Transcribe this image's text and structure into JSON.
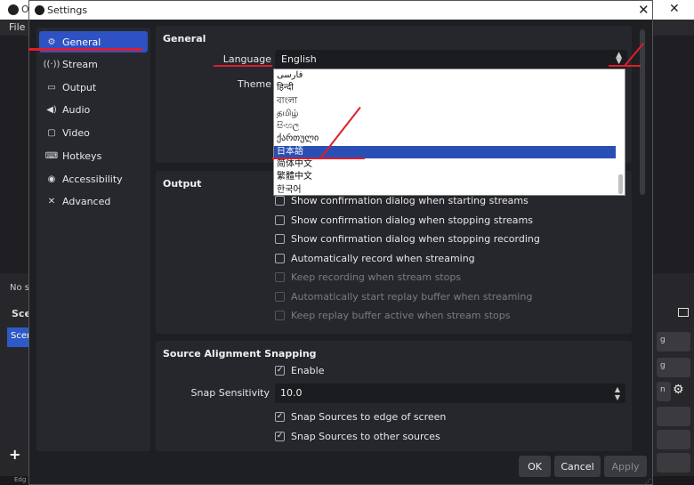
{
  "background_window": {
    "title": "Ol",
    "menu_file": "File",
    "no_source": "No so",
    "scenes_header": "Scen",
    "scene_item": "Scer",
    "plus": "+",
    "right_btn_labels": [
      "g",
      "g",
      "n"
    ],
    "bottom_text": "Edg"
  },
  "dialog": {
    "title": "Settings",
    "close": "✕"
  },
  "sidebar": {
    "items": [
      {
        "label": "General",
        "icon": "gear-icon"
      },
      {
        "label": "Stream",
        "icon": "antenna-icon"
      },
      {
        "label": "Output",
        "icon": "monitor-icon"
      },
      {
        "label": "Audio",
        "icon": "speaker-icon"
      },
      {
        "label": "Video",
        "icon": "display-icon"
      },
      {
        "label": "Hotkeys",
        "icon": "keyboard-icon"
      },
      {
        "label": "Accessibility",
        "icon": "accessibility-icon"
      },
      {
        "label": "Advanced",
        "icon": "wrench-icon"
      }
    ]
  },
  "general": {
    "title": "General",
    "language_label": "Language",
    "language_value": "English",
    "theme_label": "Theme"
  },
  "language_dropdown": {
    "options": [
      "فارسی",
      "हिन्दी",
      "বাংলা",
      "தமிழ்",
      "සිංහල",
      "ქართული",
      "日本語",
      "简体中文",
      "繁體中文",
      "한국어"
    ],
    "selected_index": 6
  },
  "output": {
    "title": "Output",
    "checks": [
      {
        "label": "Show confirmation dialog when starting streams",
        "checked": false,
        "disabled": false
      },
      {
        "label": "Show confirmation dialog when stopping streams",
        "checked": false,
        "disabled": false
      },
      {
        "label": "Show confirmation dialog when stopping recording",
        "checked": false,
        "disabled": false
      },
      {
        "label": "Automatically record when streaming",
        "checked": false,
        "disabled": false
      },
      {
        "label": "Keep recording when stream stops",
        "checked": false,
        "disabled": true
      },
      {
        "label": "Automatically start replay buffer when streaming",
        "checked": false,
        "disabled": true
      },
      {
        "label": "Keep replay buffer active when stream stops",
        "checked": false,
        "disabled": true
      }
    ]
  },
  "snapping": {
    "title": "Source Alignment Snapping",
    "enable_label": "Enable",
    "sensitivity_label": "Snap Sensitivity",
    "sensitivity_value": "10.0",
    "edge_label": "Snap Sources to edge of screen",
    "other_label": "Snap Sources to other sources"
  },
  "footer": {
    "ok": "OK",
    "cancel": "Cancel",
    "apply": "Apply"
  },
  "colors": {
    "accent": "#2e51c4",
    "annotation": "#e01c2a"
  }
}
